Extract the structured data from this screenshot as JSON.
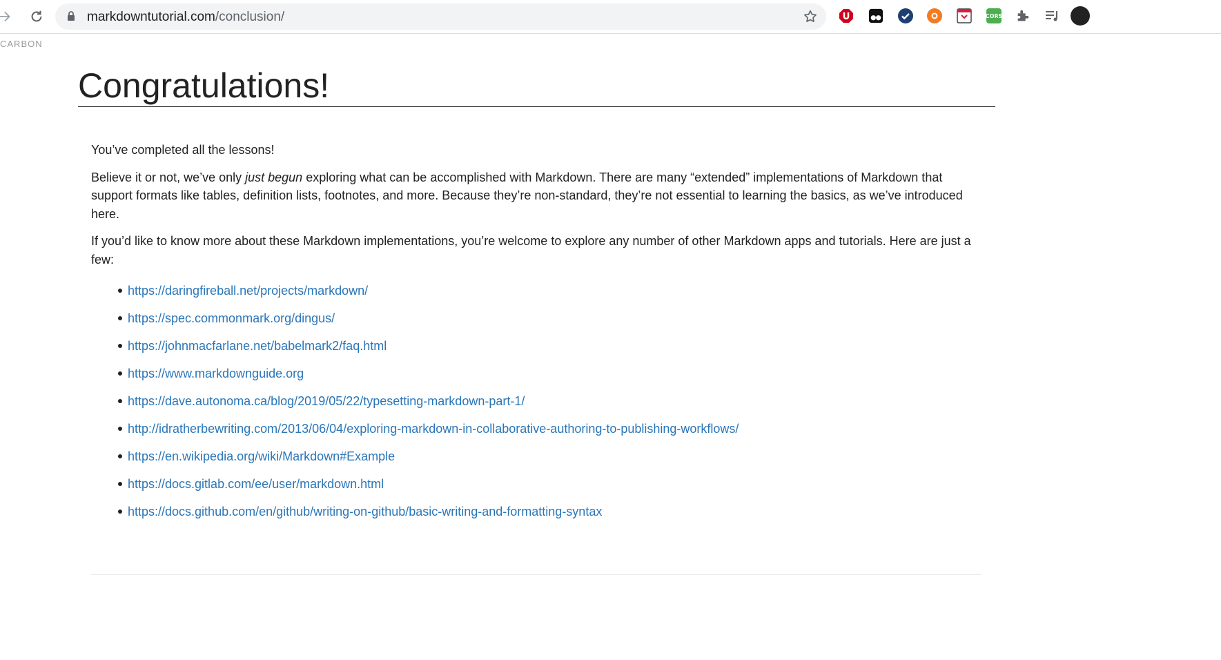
{
  "browser": {
    "url_host": "markdowntutorial.com",
    "url_path": "/conclusion/",
    "extensions": [
      "ublock-icon",
      "tampermonkey-icon",
      "checkmark-icon",
      "orange-lifebuoy-icon",
      "pocket-icon",
      "cors-icon",
      "puzzle-icon",
      "media-control-icon",
      "profile-avatar"
    ],
    "cors_label": "CORS"
  },
  "ad": {
    "label": "CARBON"
  },
  "page": {
    "title": "Congratulations!",
    "p1": "You’ve completed all the lessons!",
    "p2_before": "Believe it or not, we’ve only ",
    "p2_em": "just begun",
    "p2_after": " exploring what can be accomplished with Markdown. There are many “extended” implementations of Markdown that support formats like tables, definition lists, footnotes, and more. Because they’re non-standard, they’re not essential to learning the basics, as we’ve introduced here.",
    "p3": "If you’d like to know more about these Markdown implementations, you’re welcome to explore any number of other Markdown apps and tutorials. Here are just a few:",
    "links": [
      "https://daringfireball.net/projects/markdown/",
      "https://spec.commonmark.org/dingus/",
      "https://johnmacfarlane.net/babelmark2/faq.html",
      "https://www.markdownguide.org",
      "https://dave.autonoma.ca/blog/2019/05/22/typesetting-markdown-part-1/",
      "http://idratherbewriting.com/2013/06/04/exploring-markdown-in-collaborative-authoring-to-publishing-workflows/",
      "https://en.wikipedia.org/wiki/Markdown#Example",
      "https://docs.gitlab.com/ee/user/markdown.html",
      "https://docs.github.com/en/github/writing-on-github/basic-writing-and-formatting-syntax"
    ]
  },
  "colors": {
    "link": "#2a76b8",
    "text": "#222222",
    "omnibox": "#f1f3f4"
  }
}
